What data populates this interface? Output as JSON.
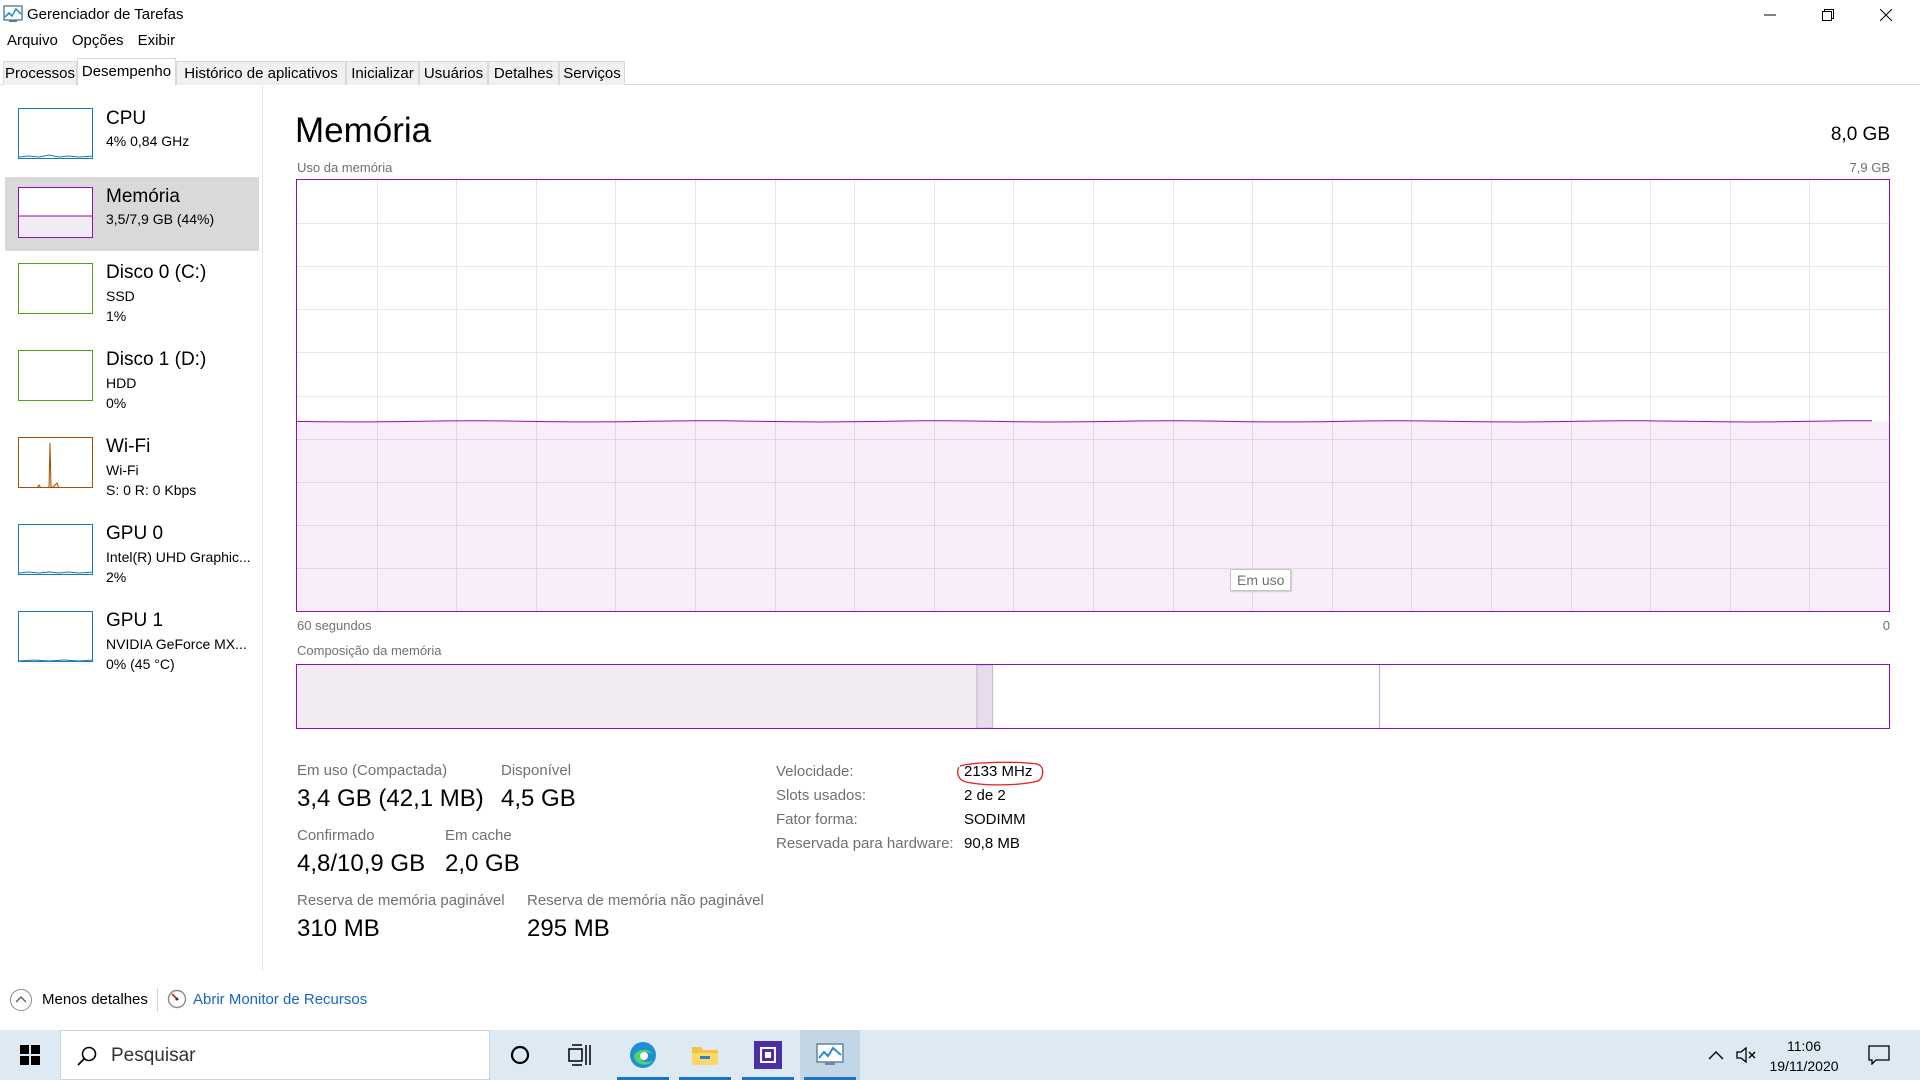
{
  "window": {
    "title": "Gerenciador de Tarefas",
    "menu": [
      "Arquivo",
      "Opções",
      "Exibir"
    ],
    "tabs": [
      "Processos",
      "Desempenho",
      "Histórico de aplicativos",
      "Inicializar",
      "Usuários",
      "Detalhes",
      "Serviços"
    ],
    "active_tab": "Desempenho"
  },
  "sidebar": {
    "items": [
      {
        "name": "CPU",
        "line1": "4% 0,84 GHz",
        "line2": "",
        "color": "#1779ba"
      },
      {
        "name": "Memória",
        "line1": "3,5/7,9 GB (44%)",
        "line2": "",
        "color": "#8b12ae"
      },
      {
        "name": "Disco 0 (C:)",
        "line1": "SSD",
        "line2": "1%",
        "color": "#4da60c"
      },
      {
        "name": "Disco 1 (D:)",
        "line1": "HDD",
        "line2": "0%",
        "color": "#4da60c"
      },
      {
        "name": "Wi-Fi",
        "line1": "Wi-Fi",
        "line2": "S: 0 R: 0 Kbps",
        "color": "#a74f01"
      },
      {
        "name": "GPU 0",
        "line1": "Intel(R) UHD Graphic...",
        "line2": "2%",
        "color": "#1779ba"
      },
      {
        "name": "GPU 1",
        "line1": "NVIDIA GeForce MX...",
        "line2": "0% (45 °C)",
        "color": "#1779ba"
      }
    ],
    "selected": "Memória"
  },
  "main": {
    "title": "Memória",
    "total": "8,0 GB",
    "usage_label": "Uso da memória",
    "usage_max": "7,9 GB",
    "time_left": "60 segundos",
    "time_right": "0",
    "usage_fraction": 0.44,
    "tooltip": "Em uso",
    "composition_label": "Composição da memória",
    "composition": {
      "in_use_fraction": 0.427,
      "modified_fraction": 0.01,
      "standby_fraction": 0.243
    }
  },
  "stats": {
    "in_use_label": "Em uso (Compactada)",
    "in_use_value": "3,4 GB (42,1 MB)",
    "available_label": "Disponível",
    "available_value": "4,5 GB",
    "committed_label": "Confirmado",
    "committed_value": "4,8/10,9 GB",
    "cached_label": "Em cache",
    "cached_value": "2,0 GB",
    "paged_label": "Reserva de memória paginável",
    "paged_value": "310 MB",
    "nonpaged_label": "Reserva de memória não paginável",
    "nonpaged_value": "295 MB"
  },
  "info": {
    "speed_label": "Velocidade:",
    "speed_value": "2133 MHz",
    "slots_label": "Slots usados:",
    "slots_value": "2 de 2",
    "form_label": "Fator forma:",
    "form_value": "SODIMM",
    "reserved_label": "Reservada para hardware:",
    "reserved_value": "90,8 MB"
  },
  "footer": {
    "less_details": "Menos detalhes",
    "resource_monitor": "Abrir Monitor de Recursos"
  },
  "taskbar": {
    "search_placeholder": "Pesquisar",
    "time": "11:06",
    "date": "19/11/2020"
  },
  "colors": {
    "memory": "#8b12ae",
    "link": "#1665c8",
    "annotation": "#e0201c"
  }
}
